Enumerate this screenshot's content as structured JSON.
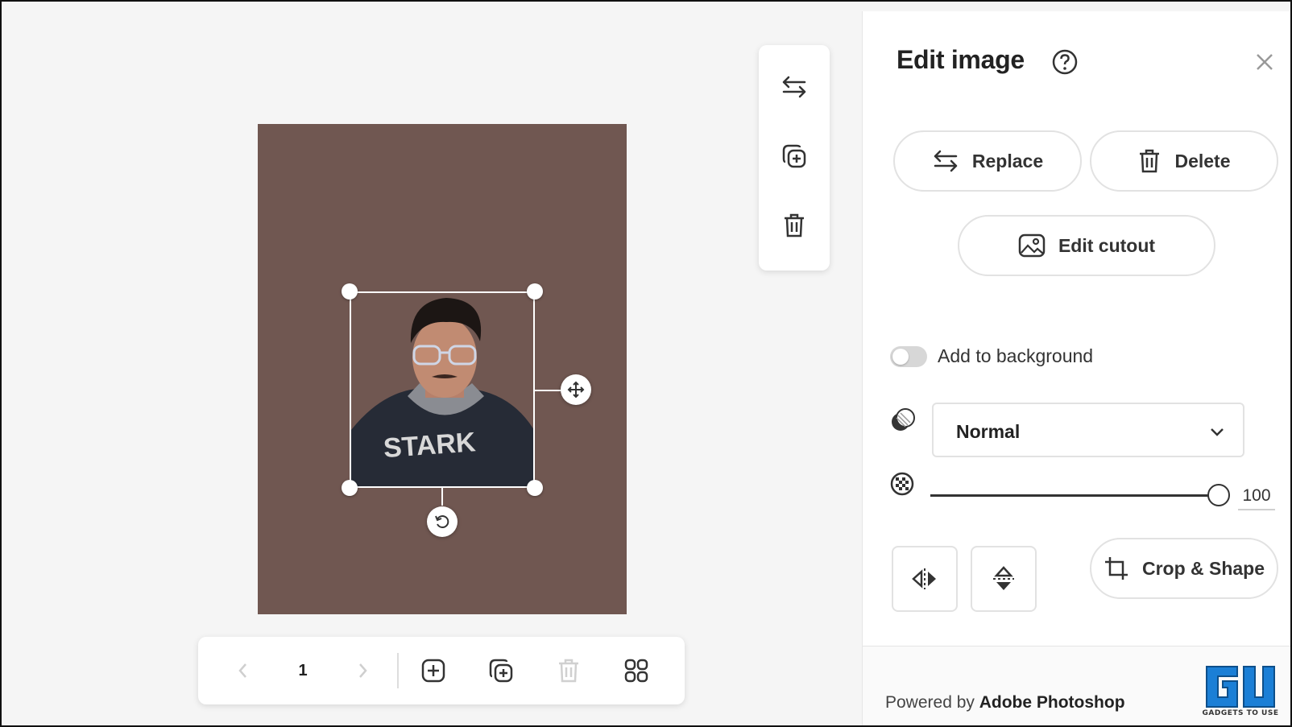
{
  "page": {
    "current": "1"
  },
  "panel": {
    "title": "Edit image",
    "buttons": {
      "replace": "Replace",
      "delete": "Delete",
      "edit_cutout": "Edit cutout",
      "crop_shape": "Crop & Shape"
    },
    "toggle": {
      "label": "Add to background",
      "on": false
    },
    "blend_mode": {
      "selected": "Normal"
    },
    "opacity": {
      "value": "100",
      "fraction": 1.0
    },
    "footer": {
      "prefix": "Powered by ",
      "brand": "Adobe Photoshop"
    }
  },
  "artboard": {
    "background": "#705751"
  },
  "icons": {
    "floating_toolbar": [
      "swap-icon",
      "duplicate-icon",
      "trash-icon"
    ],
    "page_bar": [
      "chevron-left-icon",
      "chevron-right-icon",
      "add-page-icon",
      "duplicate-page-icon",
      "trash-icon",
      "grid-icon"
    ]
  },
  "watermark": {
    "text": "GADGETS TO USE"
  }
}
